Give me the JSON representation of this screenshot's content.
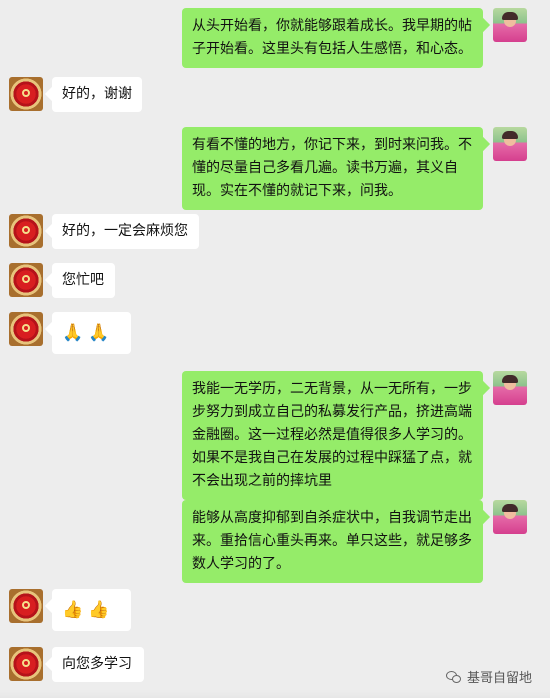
{
  "messages": [
    {
      "side": "right",
      "text": "从头开始看，你就能够跟着成长。我早期的帖子开始看。这里头有包括人生感悟，和心态。"
    },
    {
      "side": "left",
      "text": "好的，谢谢"
    },
    {
      "side": "right",
      "text": "有看不懂的地方，你记下来，到时来问我。不懂的尽量自己多看几遍。读书万遍，其义自现。实在不懂的就记下来，问我。"
    },
    {
      "side": "left",
      "text": "好的，一定会麻烦您"
    },
    {
      "side": "left",
      "text": "您忙吧"
    },
    {
      "side": "left",
      "text": "🙏🙏"
    },
    {
      "side": "right",
      "text": "我能一无学历，二无背景，从一无所有，一步步努力到成立自己的私募发行产品，挤进高端金融圈。这一过程必然是值得很多人学习的。如果不是我自己在发展的过程中踩猛了点，就不会出现之前的摔坑里"
    },
    {
      "side": "right",
      "text": "能够从高度抑郁到自杀症状中，自我调节走出来。重拾信心重头再来。单只这些，就足够多数人学习的了。"
    },
    {
      "side": "left",
      "text": "👍👍"
    },
    {
      "side": "left",
      "text": "向您多学习"
    }
  ],
  "watermark": {
    "text": "基哥自留地"
  },
  "icons": {
    "left_avatar": "red-badge-avatar",
    "right_avatar": "portrait-photo-avatar",
    "watermark": "wechat-icon"
  }
}
